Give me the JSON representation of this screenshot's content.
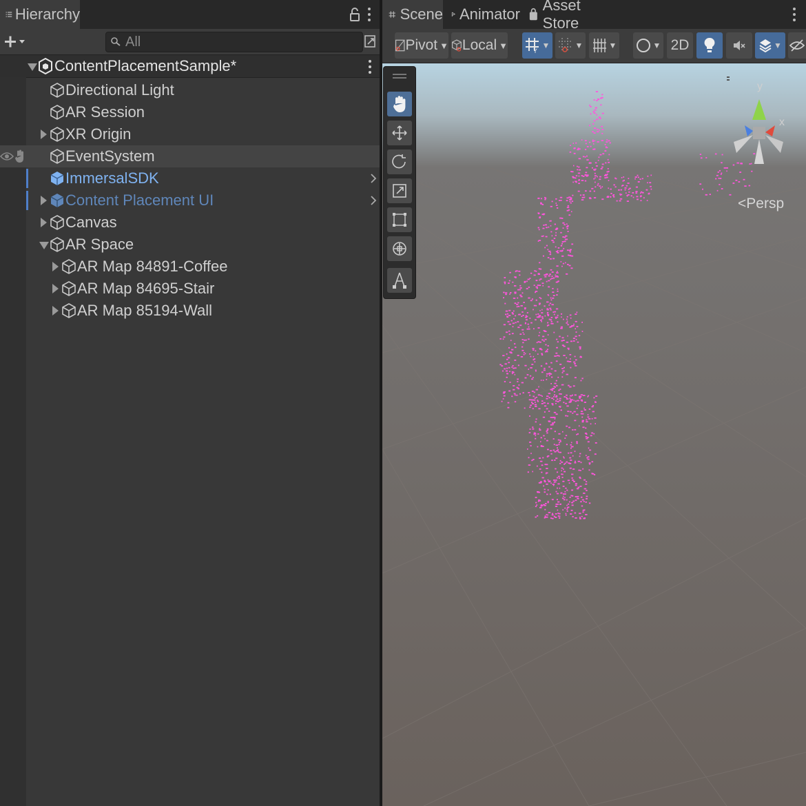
{
  "hierarchy": {
    "tab_label": "Hierarchy",
    "search_placeholder": "All",
    "scene_name": "ContentPlacementSample*",
    "items": [
      {
        "label": "Directional Light"
      },
      {
        "label": "AR Session"
      },
      {
        "label": "XR Origin"
      },
      {
        "label": "EventSystem"
      },
      {
        "label": "ImmersalSDK"
      },
      {
        "label": "Content Placement UI"
      },
      {
        "label": "Canvas"
      },
      {
        "label": "AR Space"
      },
      {
        "label": "AR Map 84891-Coffee"
      },
      {
        "label": "AR Map 84695-Stair"
      },
      {
        "label": "AR Map 85194-Wall"
      }
    ]
  },
  "tabs": [
    {
      "label": "Scene"
    },
    {
      "label": "Animator"
    },
    {
      "label": "Asset Store"
    }
  ],
  "toolbar": {
    "pivot_label": "Pivot",
    "local_label": "Local",
    "mode_2d_label": "2D"
  },
  "gizmo": {
    "y_label": "y",
    "x_label": "x",
    "persp_label": "Persp"
  },
  "colors": {
    "point_cloud": "#ff55dd",
    "accent": "#4e6f97",
    "gizmo_y": "#8fd34a",
    "gizmo_x": "#e04b3c",
    "gizmo_z": "#4a7fe0"
  }
}
